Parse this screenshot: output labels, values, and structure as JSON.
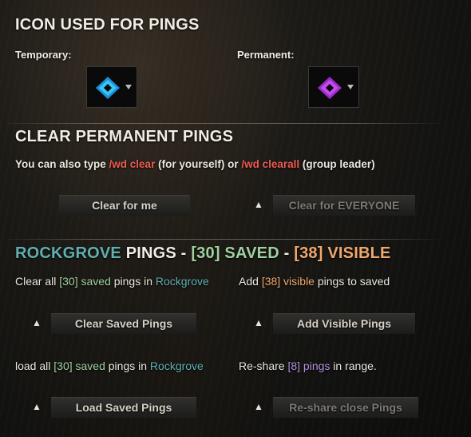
{
  "icons_section": {
    "title": "ICON USED FOR PINGS",
    "temporary_label": "Temporary:",
    "permanent_label": "Permanent:",
    "temporary_icon": "blue-diamond-ping-icon",
    "permanent_icon": "purple-diamond-ping-icon",
    "temporary_color": "#2bb4f0",
    "permanent_color": "#b53ae0"
  },
  "clear_section": {
    "title": "CLEAR PERMANENT PINGS",
    "hint_prefix": "You can also type ",
    "cmd_clear": "/wd clear",
    "hint_mid": " (for yourself) or ",
    "cmd_clearall": "/wd clearall",
    "hint_suffix": " (group leader)",
    "clear_me_label": "Clear for me",
    "clear_everyone_label": "Clear for EVERYONE"
  },
  "zone_section": {
    "zone": "ROCKGROVE",
    "title_pings": " PINGS - ",
    "saved_tag": "[30] SAVED",
    "sep": " - ",
    "visible_tag": "[38] VISIBLE",
    "clear_all_prefix": "Clear all ",
    "saved_count": "[30]",
    "saved_word": " saved",
    "pings_in": " pings in ",
    "zone_name": "Rockgrove",
    "add_prefix": "Add ",
    "visible_count": "[38]",
    "visible_word": " visible",
    "add_suffix": " pings to saved",
    "clear_saved_label": "Clear Saved Pings",
    "add_visible_label": "Add Visible Pings",
    "load_prefix": "load all ",
    "reshare_prefix": "Re-share ",
    "reshare_count": "[8]",
    "reshare_word": " pings",
    "reshare_suffix": " in range.",
    "load_saved_label": "Load Saved Pings",
    "reshare_label": "Re-share close Pings"
  },
  "colors": {
    "zone": "#5fb0b0",
    "saved": "#9fd1a0",
    "visible": "#f0a86e",
    "command": "#ec5c53",
    "reshare": "#b192e0"
  }
}
